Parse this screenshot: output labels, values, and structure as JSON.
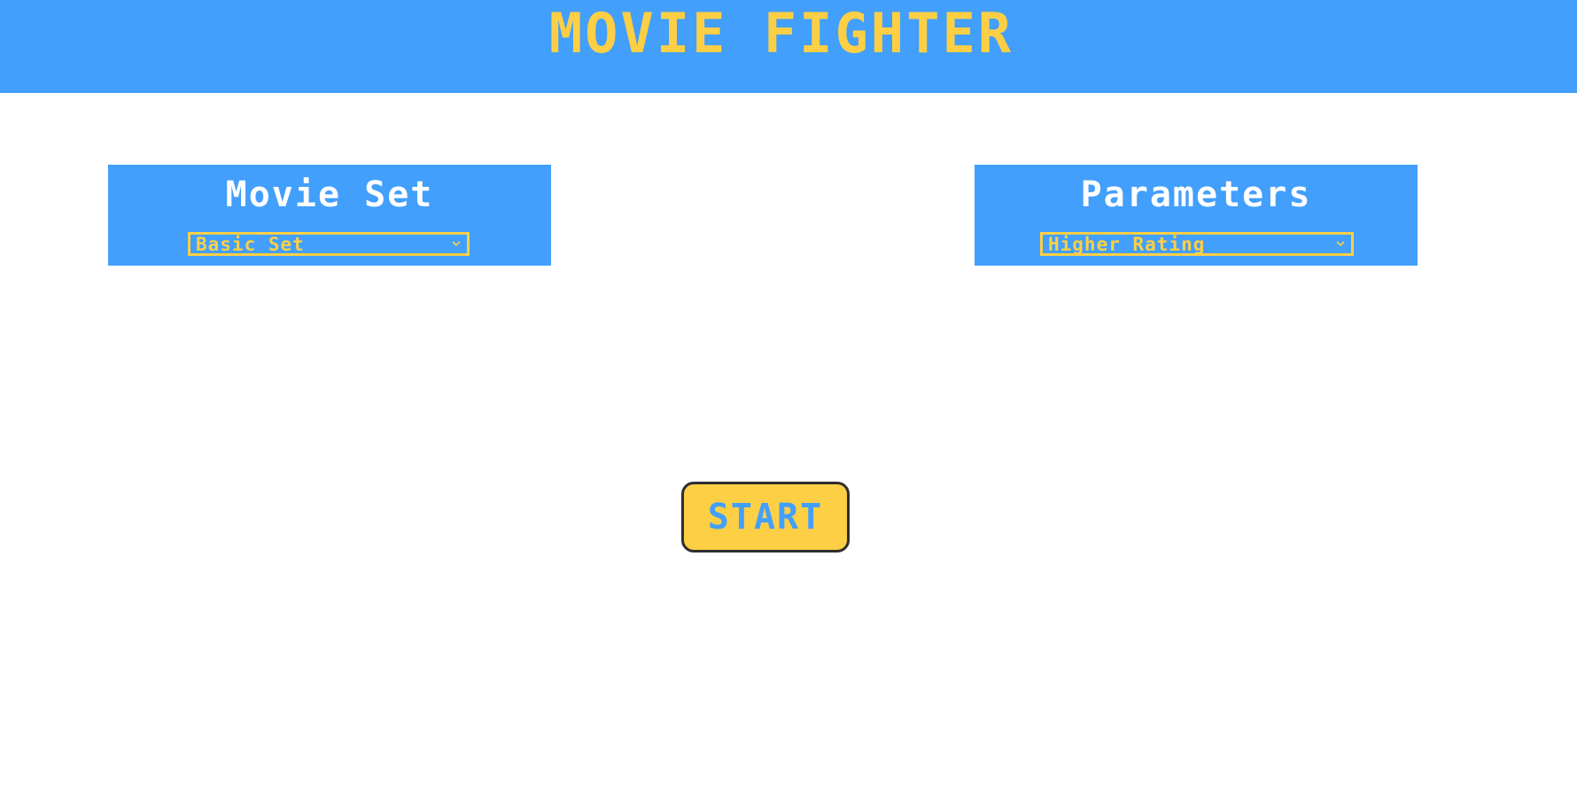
{
  "header": {
    "title": "MOVIE FIGHTER"
  },
  "movie_set": {
    "title": "Movie Set",
    "selected": "Basic Set",
    "icon": "chevron-down-icon"
  },
  "parameters": {
    "title": "Parameters",
    "selected": "Higher Rating",
    "icon": "chevron-down-icon"
  },
  "start_button": {
    "label": "START"
  },
  "colors": {
    "primary_blue": "#429ffc",
    "accent_yellow": "#fdcf45",
    "white": "#ffffff",
    "button_border": "#2e2e2e"
  }
}
